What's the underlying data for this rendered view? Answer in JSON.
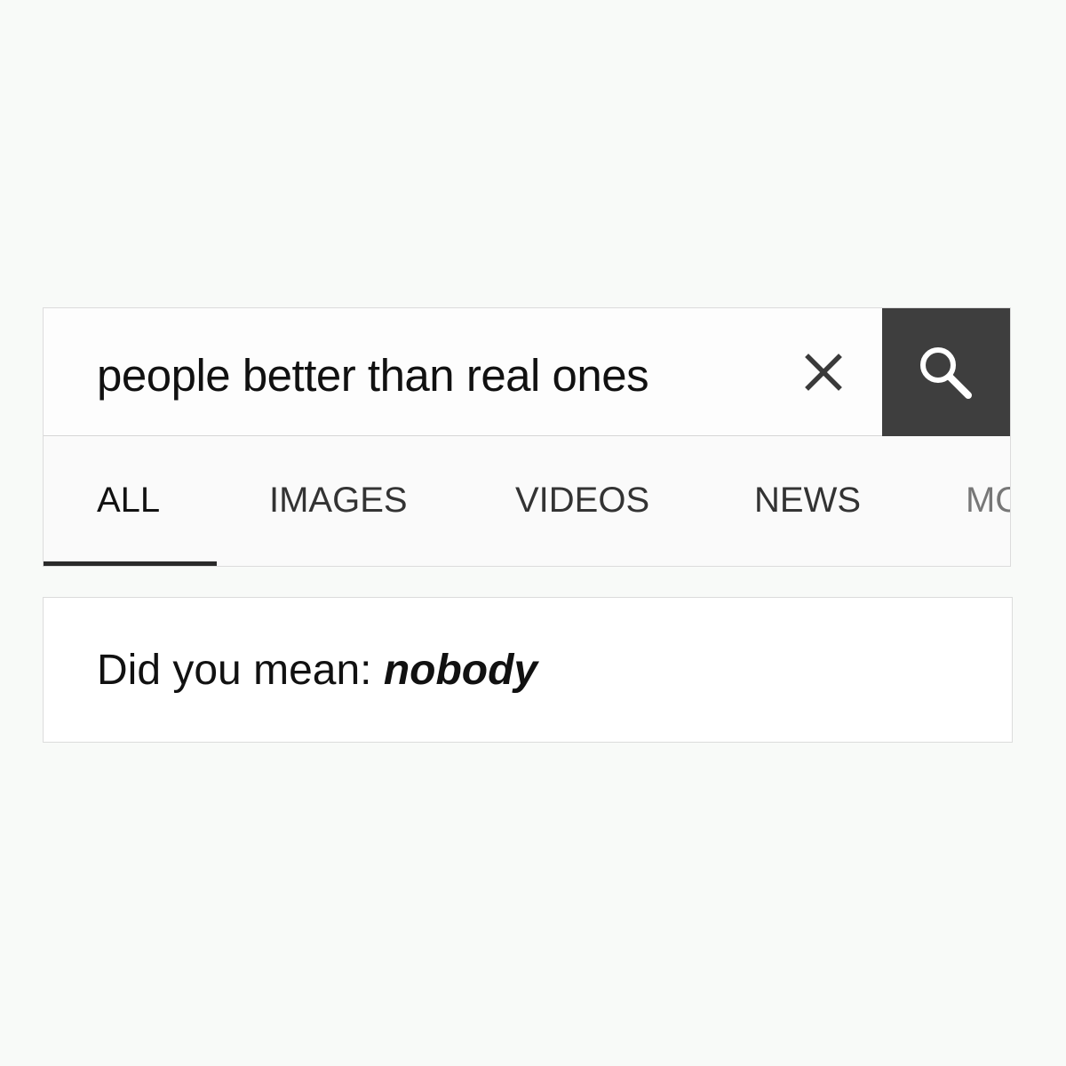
{
  "search": {
    "query": "people better than real ones",
    "clear_icon": "close-icon",
    "search_icon": "search-icon",
    "search_button_color": "#3e3e3e"
  },
  "tabs": [
    {
      "label": "ALL",
      "active": true
    },
    {
      "label": "IMAGES",
      "active": false
    },
    {
      "label": "VIDEOS",
      "active": false
    },
    {
      "label": "NEWS",
      "active": false
    },
    {
      "label": "MORE",
      "active": false
    }
  ],
  "suggestion": {
    "prefix": "Did you mean: ",
    "term": "nobody"
  }
}
